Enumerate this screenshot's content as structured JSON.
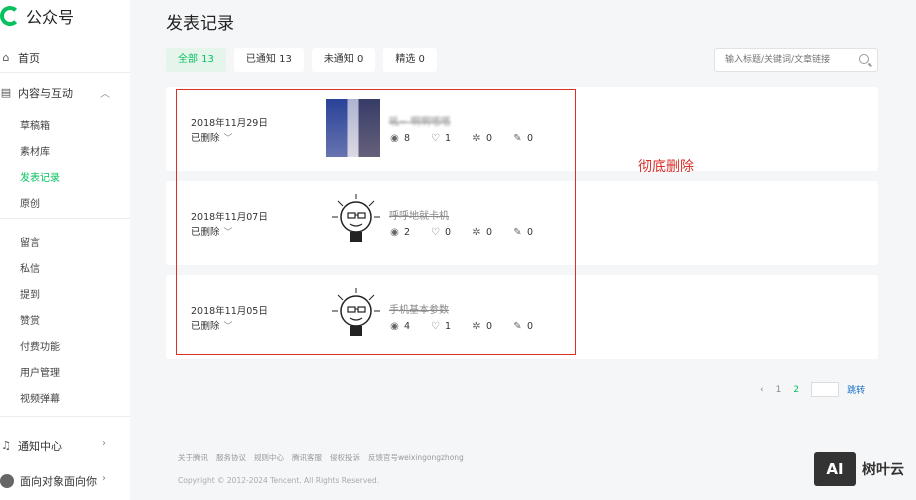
{
  "app": {
    "name": "公众号"
  },
  "sidebar": {
    "home": "首页",
    "content_group": "内容与互动",
    "content_items": [
      "草稿箱",
      "素材库",
      "发表记录",
      "原创"
    ],
    "interaction_items": [
      "留言",
      "私信",
      "提到",
      "赞赏",
      "付费功能",
      "用户管理",
      "视频弹幕"
    ],
    "notifications": "通知中心",
    "account": "面向对象面向你"
  },
  "page": {
    "title": "发表记录"
  },
  "tabs": [
    {
      "label": "全部 13"
    },
    {
      "label": "已通知 13"
    },
    {
      "label": "未通知 0"
    },
    {
      "label": "精选 0"
    }
  ],
  "search": {
    "placeholder": "输入标题/关键词/文章链接"
  },
  "records": [
    {
      "date": "2018年11月29日",
      "status": "已删除",
      "title": "吼~ 啊啊嗒嗒",
      "views": "8",
      "likes": "1",
      "shares": "0",
      "edits": "0"
    },
    {
      "date": "2018年11月07日",
      "status": "已删除",
      "title": "呼呼地就卡机",
      "views": "2",
      "likes": "0",
      "shares": "0",
      "edits": "0"
    },
    {
      "date": "2018年11月05日",
      "status": "已删除",
      "title": "手机基本参数",
      "views": "4",
      "likes": "1",
      "shares": "0",
      "edits": "0"
    }
  ],
  "annotation": "彻底删除",
  "pagination": {
    "prev": "‹",
    "pages": [
      "1",
      "2"
    ],
    "current": "2",
    "jump": "跳转"
  },
  "footer": {
    "links": [
      "关于腾讯",
      "服务协议",
      "规则中心",
      "腾讯客服",
      "侵权投诉",
      "反馈官号weixingongzhong"
    ],
    "copyright": "Copyright © 2012-2024 Tencent. All Rights Reserved."
  },
  "watermark": {
    "badge": "AI",
    "text": "树叶云"
  },
  "colors": {
    "accent": "#07c160",
    "annotation": "#d9302a"
  }
}
